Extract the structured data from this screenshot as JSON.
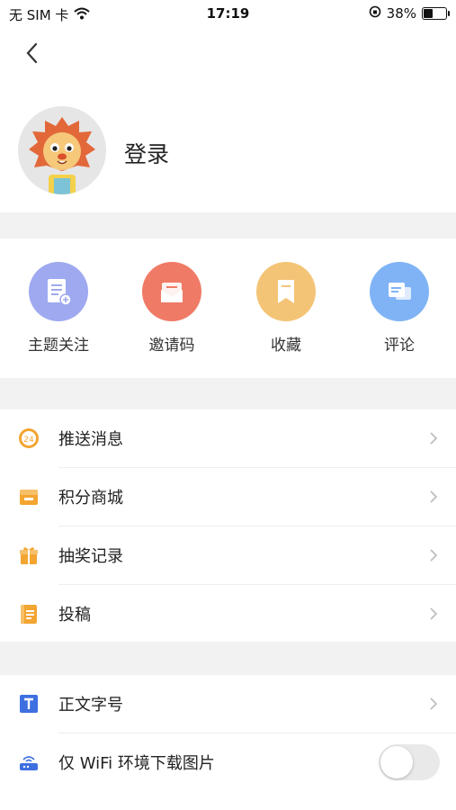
{
  "status_bar": {
    "carrier": "无 SIM 卡",
    "time": "17:19",
    "battery_percent": "38%",
    "battery_level": 0.38
  },
  "profile": {
    "login_label": "登录"
  },
  "quick_actions": [
    {
      "label": "主题关注",
      "icon": "topic-follow-icon",
      "color": "#9ea9f0"
    },
    {
      "label": "邀请码",
      "icon": "invite-mail-icon",
      "color": "#ef7a66"
    },
    {
      "label": "收藏",
      "icon": "bookmark-icon",
      "color": "#f4c476"
    },
    {
      "label": "评论",
      "icon": "comment-icon",
      "color": "#7fb3f5"
    }
  ],
  "menu_group_1": [
    {
      "label": "推送消息",
      "icon": "push-24-icon"
    },
    {
      "label": "积分商城",
      "icon": "store-icon"
    },
    {
      "label": "抽奖记录",
      "icon": "gift-icon"
    },
    {
      "label": "投稿",
      "icon": "document-icon"
    }
  ],
  "menu_group_2": [
    {
      "label": "正文字号",
      "icon": "text-size-icon"
    },
    {
      "label": "仅 WiFi 环境下载图片",
      "icon": "router-icon",
      "toggle_on": false
    }
  ],
  "colors": {
    "accent_orange": "#f3a531",
    "icon_blue": "#3d6fe0"
  }
}
